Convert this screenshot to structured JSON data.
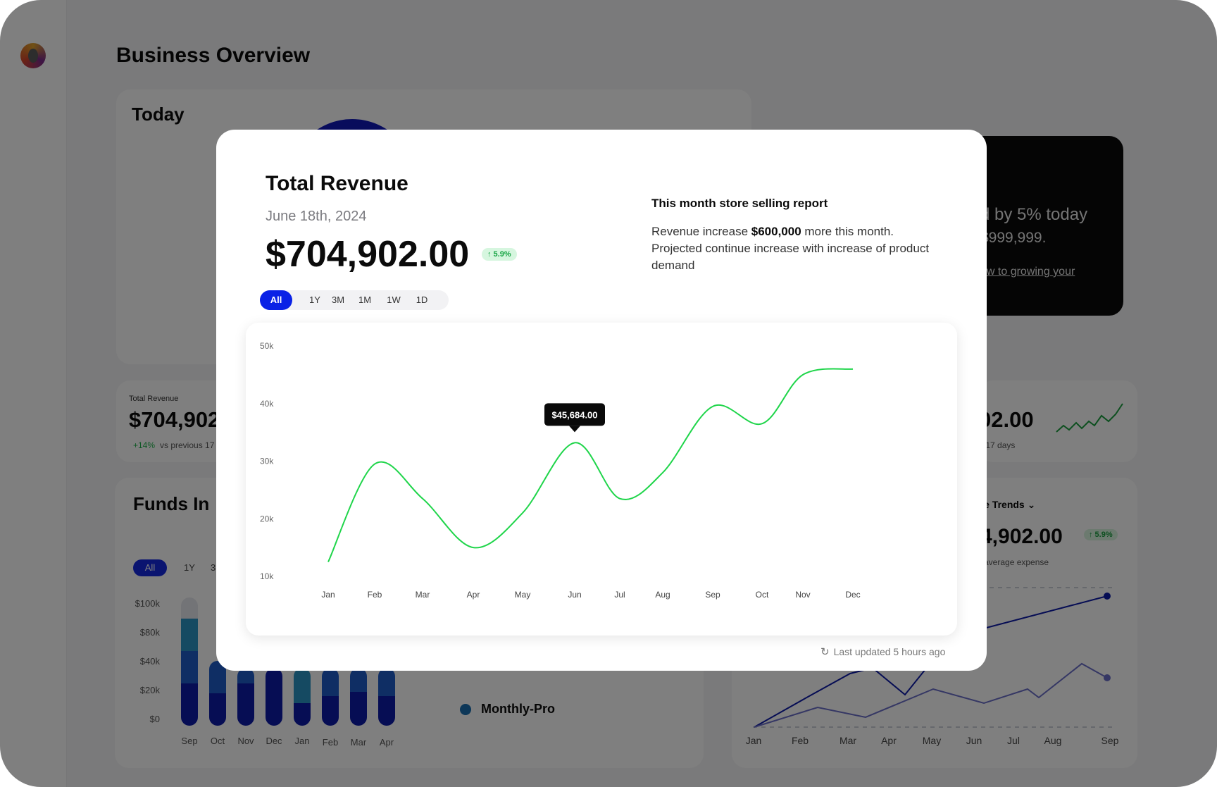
{
  "page": {
    "title": "Business Overview"
  },
  "today": {
    "title": "Today"
  },
  "promo": {
    "line1": "d by 5% today",
    "line2": "$999,999.",
    "link": "ow to growing your"
  },
  "revenue_small": {
    "label": "Total Revenue",
    "value": "$704,902",
    "delta": "+14%",
    "sub": "vs previous 17"
  },
  "revenue_small_right": {
    "value": "02.00",
    "sub": "s 17 days"
  },
  "funds": {
    "title": "Funds In",
    "filter_all": "All",
    "filter_1y": "1Y",
    "filter_3": "3",
    "y_labels": [
      "$100k",
      "$80k",
      "$40k",
      "$20k",
      "$0"
    ],
    "x_labels": [
      "Sep",
      "Oct",
      "Nov",
      "Dec",
      "Jan",
      "Feb",
      "Mar",
      "Apr"
    ],
    "legend": "Monthly-Pro",
    "colors": {
      "dark": "#0d1aa8",
      "mid": "#1f5cc8",
      "light": "#2a95c4"
    }
  },
  "expense": {
    "title": "ense Trends",
    "value": "4,902.00",
    "badge": "↑ 5.9%",
    "sub": "average expense",
    "x_labels": [
      "Jan",
      "Feb",
      "Mar",
      "Apr",
      "May",
      "Jun",
      "Jul",
      "Aug",
      "Sep"
    ]
  },
  "modal": {
    "title": "Total Revenue",
    "date": "June 18th, 2024",
    "amount": "$704,902.00",
    "badge": "↑ 5.9%",
    "tabs": [
      "All",
      "1Y",
      "3M",
      "1M",
      "1W",
      "1D"
    ],
    "active_tab": "All",
    "report_title": "This month store selling report",
    "report_pre": "Revenue increase ",
    "report_highlight": "$600,000",
    "report_post": " more this month. Projected continue increase with increase of product demand",
    "updated": "Last updated 5 hours ago",
    "refresh_icon": "refresh-icon"
  },
  "chart_data": {
    "type": "line",
    "categories": [
      "Jan",
      "Feb",
      "Mar",
      "Apr",
      "May",
      "Jun",
      "Jul",
      "Aug",
      "Sep",
      "Oct",
      "Nov",
      "Dec"
    ],
    "y_tick_labels": [
      "50k",
      "40k",
      "30k",
      "20k",
      "10k"
    ],
    "ylim": [
      10000,
      50000
    ],
    "series": [
      {
        "x": [
          "Jan",
          "Feb",
          "Mar",
          "Apr",
          "May",
          "Jun",
          "Jul",
          "Aug",
          "Sep",
          "Oct",
          "Nov",
          "Dec"
        ],
        "values": [
          12500,
          29500,
          23500,
          15000,
          21000,
          33200,
          23500,
          28000,
          39500,
          36500,
          45000,
          46000
        ],
        "color": "#1fd54a"
      }
    ],
    "tooltip": {
      "category": "Jun",
      "label": "$45,684.00"
    },
    "grid": false,
    "legend": "none"
  }
}
